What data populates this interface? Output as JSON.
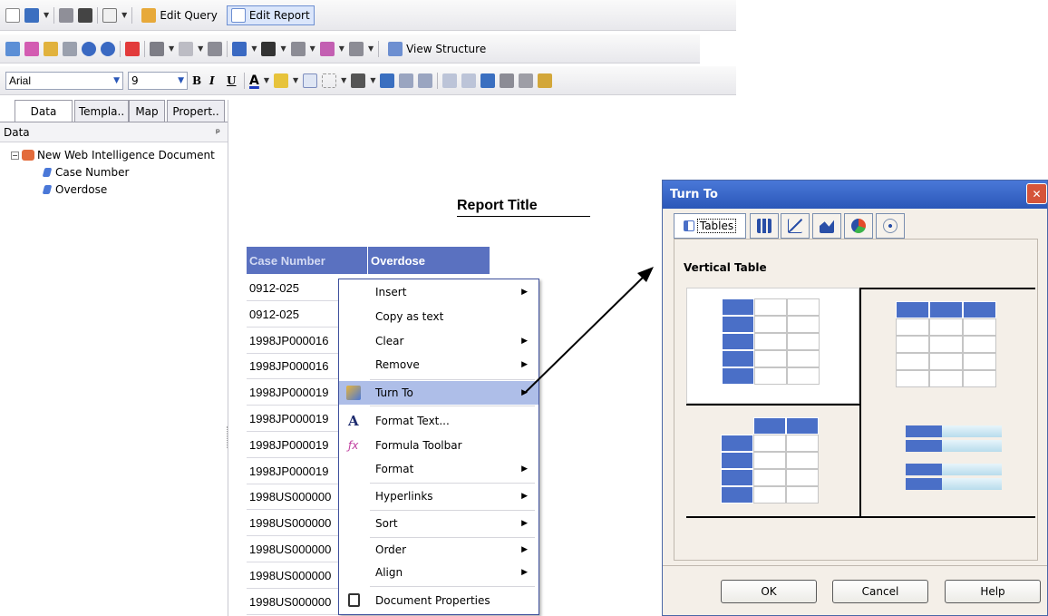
{
  "toolbar1": {
    "edit_query": "Edit Query",
    "edit_report": "Edit Report"
  },
  "toolbar2": {
    "view_structure": "View Structure"
  },
  "toolbar3": {
    "font": "Arial",
    "size": "9",
    "bold": "B",
    "italic": "I",
    "underline": "U",
    "color_a": "A"
  },
  "left_tabs": [
    {
      "label": "Data"
    },
    {
      "label": "Templa.."
    },
    {
      "label": "Map"
    },
    {
      "label": "Propert.."
    }
  ],
  "panel": {
    "title": "Data",
    "pin": "ᵖ"
  },
  "tree": {
    "root": "New Web Intelligence Document",
    "children": [
      "Case Number",
      "Overdose"
    ]
  },
  "report": {
    "title": "Report Title"
  },
  "table": {
    "headers": [
      "Case Number",
      "Overdose"
    ],
    "rows": [
      "0912-025",
      "0912-025",
      "1998JP000016",
      "1998JP000016",
      "1998JP000019",
      "1998JP000019",
      "1998JP000019",
      "1998JP000019",
      "1998US000000",
      "1998US000000",
      "1998US000000",
      "1998US000000",
      "1998US000000"
    ]
  },
  "context_menu": {
    "items": [
      "Insert",
      "Copy as text",
      "Clear",
      "Remove",
      "Turn To",
      "Format Text...",
      "Formula Toolbar",
      "Format",
      "Hyperlinks",
      "Sort",
      "Order",
      "Align",
      "Document Properties"
    ]
  },
  "dialog": {
    "title": "Turn To",
    "close": "✕",
    "tabs": [
      {
        "label": "Tables"
      }
    ],
    "section": "Vertical Table",
    "buttons": {
      "ok": "OK",
      "cancel": "Cancel",
      "help": "Help"
    }
  },
  "colors": {
    "header_bg": "#5a71c0",
    "cell_blue": "#4a6fc7",
    "highlight": "#aebee8",
    "title_bar": "#2a57b8"
  }
}
